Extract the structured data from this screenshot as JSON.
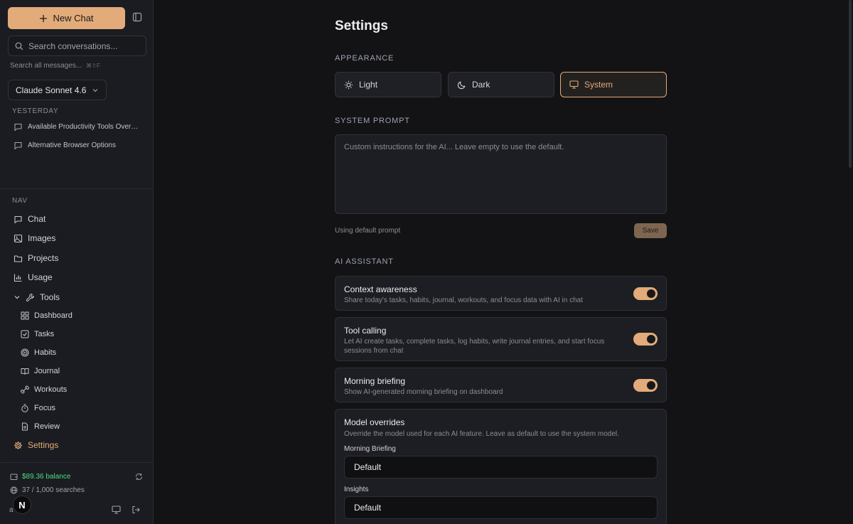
{
  "sidebar": {
    "new_chat_label": "New Chat",
    "search_placeholder": "Search conversations...",
    "search_all_label": "Search all messages...",
    "search_all_shortcut": "⌘⇧F",
    "model_label": "Claude Sonnet 4.6",
    "history_section": "YESTERDAY",
    "conversations": [
      "Available Productivity Tools Overview",
      "Alternative Browser Options"
    ],
    "nav_section": "NAV",
    "nav": {
      "chat": "Chat",
      "images": "Images",
      "projects": "Projects",
      "usage": "Usage",
      "tools": "Tools",
      "dashboard": "Dashboard",
      "tasks": "Tasks",
      "habits": "Habits",
      "journal": "Journal",
      "workouts": "Workouts",
      "focus": "Focus",
      "review": "Review",
      "settings": "Settings"
    },
    "balance": "$89.36 balance",
    "searches": "37 / 1,000 searches",
    "avatar_letter": "N",
    "avatar_under": "a"
  },
  "settings": {
    "title": "Settings",
    "appearance_heading": "APPEARANCE",
    "themes": {
      "light": "Light",
      "dark": "Dark",
      "system": "System"
    },
    "selected_theme": "System",
    "system_prompt_heading": "SYSTEM PROMPT",
    "system_prompt_placeholder": "Custom instructions for the AI... Leave empty to use the default.",
    "system_prompt_value": "",
    "prompt_status": "Using default prompt",
    "save_label": "Save",
    "ai_heading": "AI ASSISTANT",
    "context": {
      "title": "Context awareness",
      "desc": "Share today's tasks, habits, journal, workouts, and focus data with AI in chat",
      "enabled": true
    },
    "tools": {
      "title": "Tool calling",
      "desc": "Let AI create tasks, complete tasks, log habits, write journal entries, and start focus sessions from chat",
      "enabled": true
    },
    "briefing": {
      "title": "Morning briefing",
      "desc": "Show AI-generated morning briefing on dashboard",
      "enabled": true
    },
    "overrides": {
      "title": "Model overrides",
      "desc": "Override the model used for each AI feature. Leave as default to use the system model.",
      "morning_label": "Morning Briefing",
      "morning_value": "Default",
      "insights_label": "Insights",
      "insights_value": "Default"
    }
  },
  "colors": {
    "accent": "#e2ab79",
    "balance_green": "#4ade80",
    "background": "#131316",
    "sidebar": "#1b1c21"
  }
}
